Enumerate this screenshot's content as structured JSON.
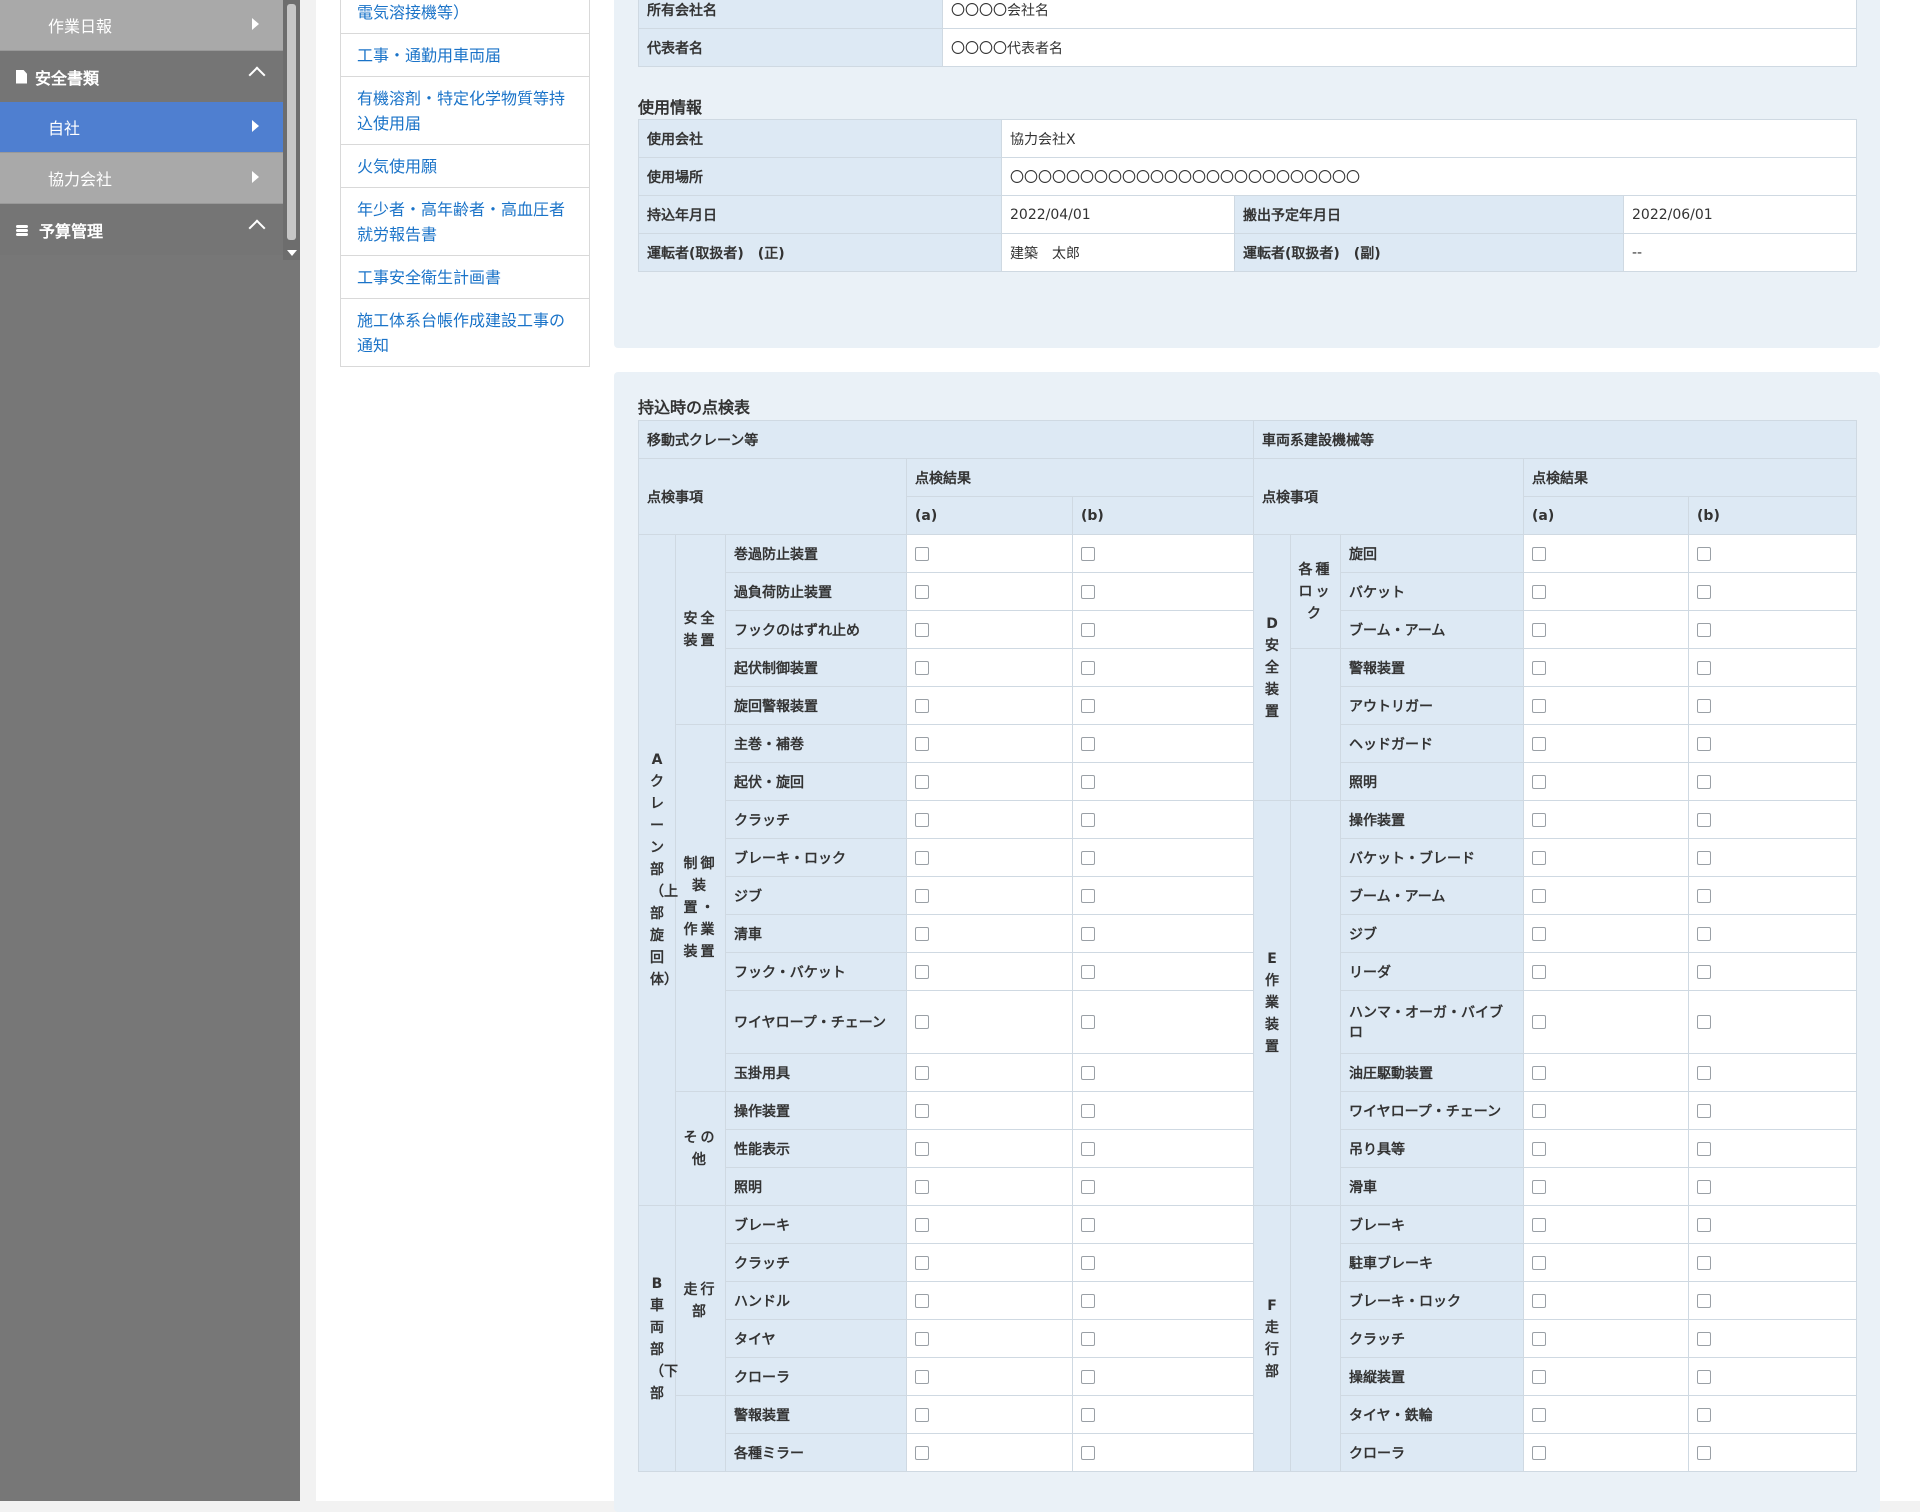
{
  "sidebar": {
    "items": [
      {
        "type": "sub",
        "label": "作業日報",
        "active": false
      },
      {
        "type": "section",
        "label": "安全書類",
        "icon": "document-icon"
      },
      {
        "type": "sub",
        "label": "自社",
        "active": true
      },
      {
        "type": "sub",
        "label": "協力会社",
        "active": false
      },
      {
        "type": "section",
        "label": "予算管理",
        "icon": "coins-icon"
      }
    ]
  },
  "doc_nav": {
    "items": [
      "電気溶接機等）",
      "工事・通勤用車両届",
      "有機溶剤・特定化学物質等持込使用届",
      "火気使用願",
      "年少者・高年齢者・高血圧者就労報告書",
      "工事安全衛生計画書",
      "施工体系台帳作成建設工事の通知"
    ]
  },
  "owner_info": {
    "rows": [
      {
        "label": "所有会社名",
        "value": "〇〇〇〇会社名"
      },
      {
        "label": "代表者名",
        "value": "〇〇〇〇代表者名"
      }
    ]
  },
  "usage_info": {
    "title": "使用情報",
    "company_label": "使用会社",
    "company_value": "協力会社X",
    "place_label": "使用場所",
    "place_value": "〇〇〇〇〇〇〇〇〇〇〇〇〇〇〇〇〇〇〇〇〇〇〇〇〇",
    "bring_in_label": "持込年月日",
    "bring_in_value": "2022/04/01",
    "carry_out_label": "搬出予定年月日",
    "carry_out_value": "2022/06/01",
    "driver_main_label": "運転者(取扱者)　(正)",
    "driver_main_value": "建築　太郎",
    "driver_sub_label": "運転者(取扱者)　(副)",
    "driver_sub_value": "--"
  },
  "inspection": {
    "title": "持込時の点検表",
    "left_header": "移動式クレーン等",
    "right_header": "車両系建設機械等",
    "item_header": "点検事項",
    "result_header": "点検結果",
    "col_a": "(a)",
    "col_b": "(b)",
    "left_cats": [
      {
        "label": "Aクレーン部（上部旋回体）",
        "rows": 17
      },
      {
        "label": "B車両部（下部",
        "rows": 7
      }
    ],
    "left_groups": [
      {
        "label": "安全装置",
        "rows": 5
      },
      {
        "label": "制御装置・作業装置",
        "rows": 9
      },
      {
        "label": "その他",
        "rows": 3
      },
      {
        "label": "走行部",
        "rows": 5
      },
      {
        "label": "",
        "rows": 2
      }
    ],
    "left_items": [
      "巻過防止装置",
      "過負荷防止装置",
      "フックのはずれ止め",
      "起伏制御装置",
      "旋回警報装置",
      "主巻・補巻",
      "起伏・旋回",
      "クラッチ",
      "ブレーキ・ロック",
      "ジブ",
      "清車",
      "フック・バケット",
      "ワイヤロープ・チェーン",
      "玉掛用具",
      "操作装置",
      "性能表示",
      "照明",
      "ブレーキ",
      "クラッチ",
      "ハンドル",
      "タイヤ",
      "クローラ",
      "警報装置",
      "各種ミラー"
    ],
    "right_cats": [
      {
        "label": "D安全装置",
        "rows": 7
      },
      {
        "label": "E作業装置",
        "rows": 10
      },
      {
        "label": "F走行部",
        "rows": 7
      }
    ],
    "right_groups": [
      {
        "label": "各種ロック",
        "rows": 3
      },
      {
        "label": "",
        "rows": 4
      },
      {
        "label": "",
        "rows": 10
      },
      {
        "label": "",
        "rows": 7
      }
    ],
    "right_items": [
      "旋回",
      "バケット",
      "ブーム・アーム",
      "警報装置",
      "アウトリガー",
      "ヘッドガード",
      "照明",
      "操作装置",
      "バケット・ブレード",
      "ブーム・アーム",
      "ジブ",
      "リーダ",
      "ハンマ・オーガ・バイブロ",
      "油圧駆動装置",
      "ワイヤロープ・チェーン",
      "吊り具等",
      "滑車",
      "ブレーキ",
      "駐車ブレーキ",
      "ブレーキ・ロック",
      "クラッチ",
      "操縦装置",
      "タイヤ・鉄輪",
      "クローラ"
    ]
  }
}
